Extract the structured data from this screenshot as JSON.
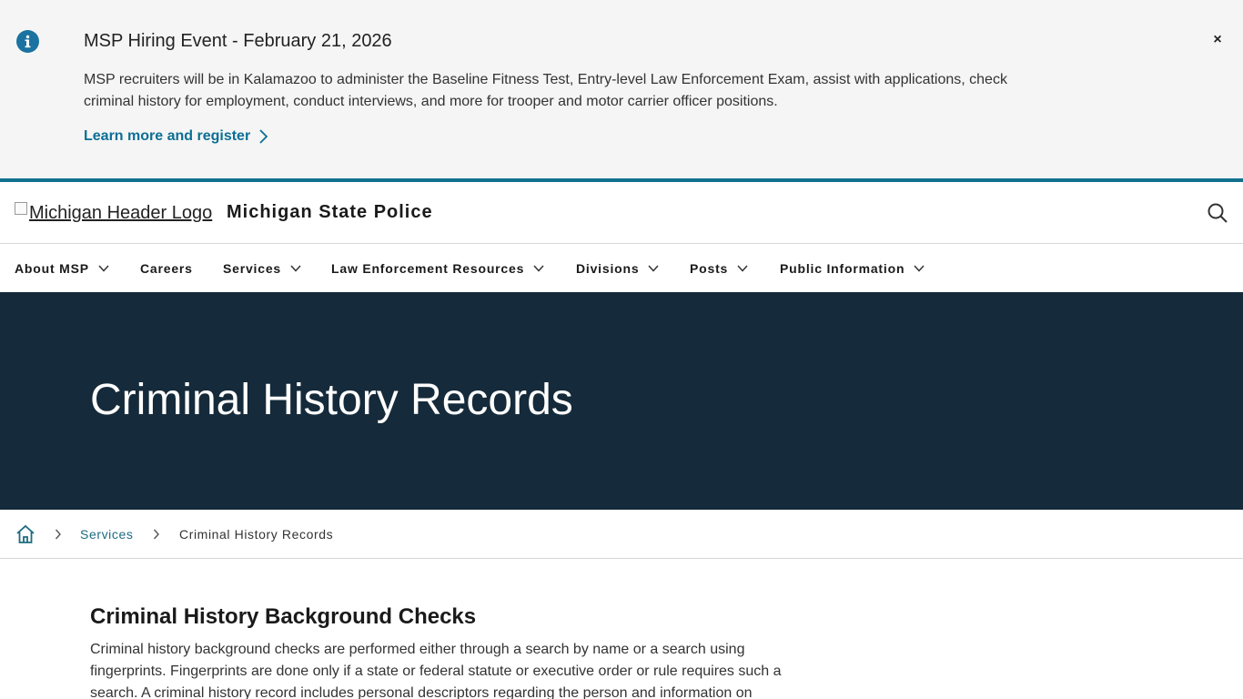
{
  "alert": {
    "title": "MSP Hiring Event - February 21, 2026",
    "body": "MSP recruiters will be in Kalamazoo to administer the Baseline Fitness Test, Entry-level Law Enforcement Exam, assist with applications, check criminal history for employment, conduct interviews, and more for trooper and motor carrier officer positions.",
    "link_label": "Learn more and register",
    "close_label": "×",
    "icon": "info-icon"
  },
  "header": {
    "logo_alt": "Michigan Header Logo",
    "site_name": "Michigan State Police",
    "search_icon": "search-icon"
  },
  "nav": {
    "items": [
      {
        "label": "About MSP",
        "has_dropdown": true
      },
      {
        "label": "Careers",
        "has_dropdown": false
      },
      {
        "label": "Services",
        "has_dropdown": true
      },
      {
        "label": "Law Enforcement Resources",
        "has_dropdown": true
      },
      {
        "label": "Divisions",
        "has_dropdown": true
      },
      {
        "label": "Posts",
        "has_dropdown": true
      },
      {
        "label": "Public Information",
        "has_dropdown": true
      }
    ]
  },
  "hero": {
    "title": "Criminal History Records"
  },
  "breadcrumb": {
    "home_icon": "home-icon",
    "items": [
      "Services",
      "Criminal History Records"
    ]
  },
  "content": {
    "heading": "Criminal History Background Checks",
    "paragraph": "Criminal history background checks are performed either through a search by name or a search using fingerprints. Fingerprints are done only if a state or federal statute or executive order or rule requires such a search. A criminal history record includes personal descriptors regarding the person and information on"
  },
  "colors": {
    "alert_bg": "#f5f5f5",
    "accent": "#12708f",
    "link": "#0b6f95",
    "hero_bg": "#152a3a"
  }
}
